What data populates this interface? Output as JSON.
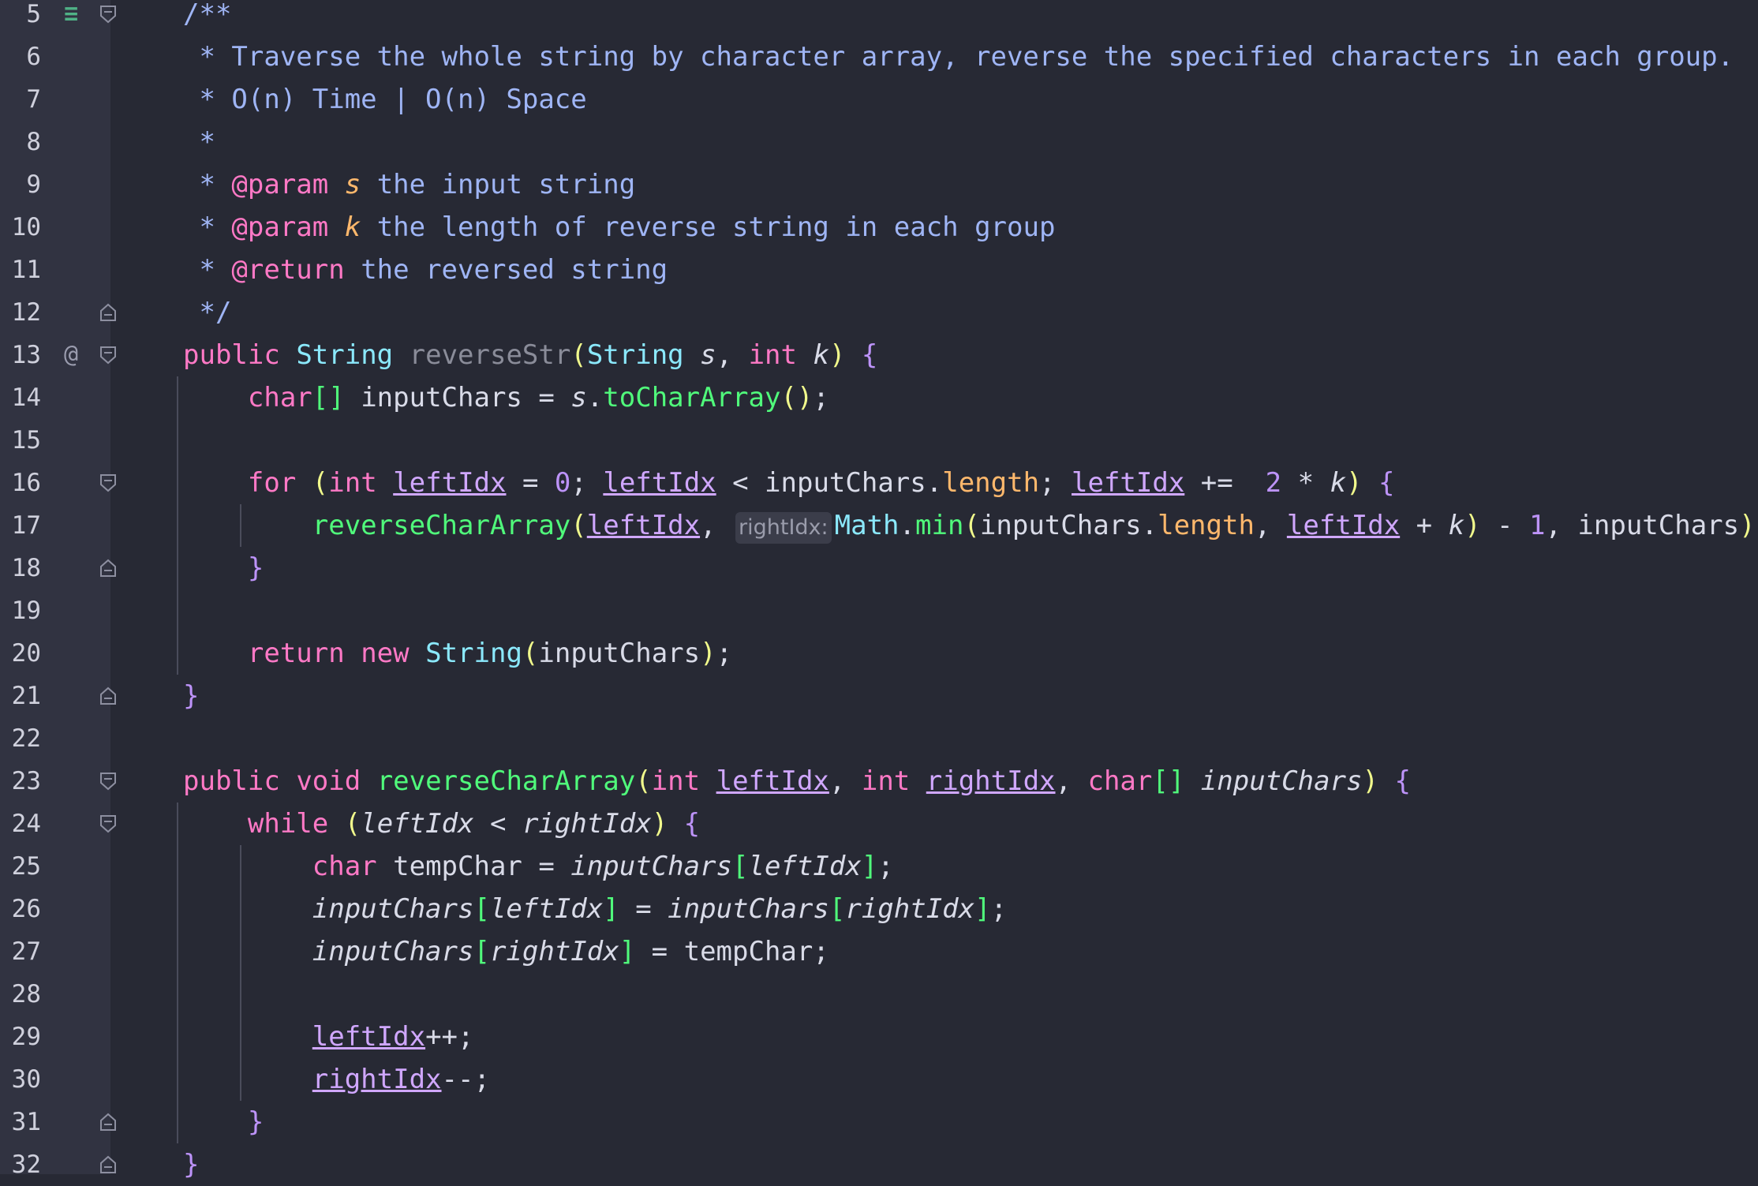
{
  "editor": {
    "lines": [
      {
        "n": "5",
        "icon": "implementation-gutter-icon",
        "fold": "open",
        "tokens": [
          [
            "/**",
            "cm"
          ]
        ]
      },
      {
        "n": "6",
        "tokens": [
          [
            " * Traverse the whole string by character array, reverse the specified characters in each group.",
            "cm"
          ]
        ]
      },
      {
        "n": "7",
        "tokens": [
          [
            " * O(n) Time | O(n) Space",
            "cm"
          ]
        ]
      },
      {
        "n": "8",
        "tokens": [
          [
            " *",
            "cm"
          ]
        ]
      },
      {
        "n": "9",
        "tokens": [
          [
            " * ",
            "cm"
          ],
          [
            "@param",
            "tag"
          ],
          [
            " ",
            "cm"
          ],
          [
            "s",
            "pn"
          ],
          [
            " the input string",
            "cm"
          ]
        ]
      },
      {
        "n": "10",
        "tokens": [
          [
            " * ",
            "cm"
          ],
          [
            "@param",
            "tag"
          ],
          [
            " ",
            "cm"
          ],
          [
            "k",
            "pn"
          ],
          [
            " the length of reverse string in each group",
            "cm"
          ]
        ]
      },
      {
        "n": "11",
        "tokens": [
          [
            " * ",
            "cm"
          ],
          [
            "@return",
            "tag"
          ],
          [
            " the reversed string",
            "cm"
          ]
        ]
      },
      {
        "n": "12",
        "fold": "close",
        "tokens": [
          [
            " */",
            "cm"
          ]
        ]
      },
      {
        "n": "13",
        "icon": "override-at-icon",
        "fold": "open",
        "tokens": [
          [
            "public",
            "kw"
          ],
          [
            " ",
            ""
          ],
          [
            "String",
            "ty"
          ],
          [
            " ",
            ""
          ],
          [
            "reverseStr",
            "fn2"
          ],
          [
            "(",
            "pa"
          ],
          [
            "String",
            "ty"
          ],
          [
            " ",
            ""
          ],
          [
            "s",
            "pi"
          ],
          [
            ", ",
            ""
          ],
          [
            "int",
            "kw"
          ],
          [
            " ",
            ""
          ],
          [
            "k",
            "pi"
          ],
          [
            ")",
            "pa"
          ],
          [
            " ",
            ""
          ],
          [
            "{",
            "br"
          ]
        ]
      },
      {
        "n": "14",
        "tokens": [
          [
            "    ",
            ""
          ],
          [
            "char",
            "kw"
          ],
          [
            "[]",
            "bk"
          ],
          [
            " inputChars = ",
            ""
          ],
          [
            "s",
            "pi"
          ],
          [
            ".",
            ""
          ],
          [
            "toCharArray",
            "fn"
          ],
          [
            "()",
            "pa"
          ],
          [
            ";",
            ""
          ]
        ]
      },
      {
        "n": "15",
        "tokens": []
      },
      {
        "n": "16",
        "fold": "open",
        "tokens": [
          [
            "    ",
            ""
          ],
          [
            "for",
            "kw"
          ],
          [
            " ",
            ""
          ],
          [
            "(",
            "pa"
          ],
          [
            "int",
            "kw"
          ],
          [
            " ",
            ""
          ],
          [
            "leftIdx",
            "lv"
          ],
          [
            " = ",
            ""
          ],
          [
            "0",
            "nu"
          ],
          [
            "; ",
            ""
          ],
          [
            "leftIdx",
            "lv"
          ],
          [
            " < inputChars.",
            ""
          ],
          [
            "length",
            "fd"
          ],
          [
            "; ",
            ""
          ],
          [
            "leftIdx",
            "lv"
          ],
          [
            " +=  ",
            ""
          ],
          [
            "2",
            "nu"
          ],
          [
            " * ",
            ""
          ],
          [
            "k",
            "pi"
          ],
          [
            ")",
            "pa"
          ],
          [
            " ",
            ""
          ],
          [
            "{",
            "br"
          ]
        ]
      },
      {
        "n": "17",
        "tokens": [
          [
            "        ",
            ""
          ],
          [
            "reverseCharArray",
            "fn"
          ],
          [
            "(",
            "pa"
          ],
          [
            "leftIdx",
            "lv"
          ],
          [
            ", ",
            ""
          ],
          [
            "rightIdx:",
            "hint"
          ],
          [
            "Math",
            "ty"
          ],
          [
            ".",
            ""
          ],
          [
            "min",
            "fn"
          ],
          [
            "(",
            "pa"
          ],
          [
            "inputChars.",
            ""
          ],
          [
            "length",
            "fd"
          ],
          [
            ", ",
            ""
          ],
          [
            "leftIdx",
            "lv"
          ],
          [
            " + ",
            ""
          ],
          [
            "k",
            "pi"
          ],
          [
            ")",
            "pa"
          ],
          [
            " - ",
            ""
          ],
          [
            "1",
            "nu"
          ],
          [
            ", inputChars",
            ""
          ],
          [
            ")",
            "pa"
          ],
          [
            ";",
            ""
          ]
        ]
      },
      {
        "n": "18",
        "fold": "close",
        "tokens": [
          [
            "    ",
            ""
          ],
          [
            "}",
            "br"
          ]
        ]
      },
      {
        "n": "19",
        "tokens": []
      },
      {
        "n": "20",
        "tokens": [
          [
            "    ",
            ""
          ],
          [
            "return",
            "kw"
          ],
          [
            " ",
            ""
          ],
          [
            "new",
            "kw"
          ],
          [
            " ",
            ""
          ],
          [
            "String",
            "ty"
          ],
          [
            "(",
            "pa"
          ],
          [
            "inputChars",
            ""
          ],
          [
            ")",
            "pa"
          ],
          [
            ";",
            ""
          ]
        ]
      },
      {
        "n": "21",
        "fold": "close",
        "tokens": [
          [
            "}",
            "br"
          ]
        ]
      },
      {
        "n": "22",
        "tokens": []
      },
      {
        "n": "23",
        "fold": "open",
        "tokens": [
          [
            "public",
            "kw"
          ],
          [
            " ",
            ""
          ],
          [
            "void",
            "kw"
          ],
          [
            " ",
            ""
          ],
          [
            "reverseCharArray",
            "fn"
          ],
          [
            "(",
            "pa"
          ],
          [
            "int",
            "kw"
          ],
          [
            " ",
            ""
          ],
          [
            "leftIdx",
            "lv"
          ],
          [
            ", ",
            ""
          ],
          [
            "int",
            "kw"
          ],
          [
            " ",
            ""
          ],
          [
            "rightIdx",
            "lv"
          ],
          [
            ", ",
            ""
          ],
          [
            "char",
            "kw"
          ],
          [
            "[]",
            "bk"
          ],
          [
            " ",
            ""
          ],
          [
            "inputChars",
            "pi"
          ],
          [
            ")",
            "pa"
          ],
          [
            " ",
            ""
          ],
          [
            "{",
            "br"
          ]
        ]
      },
      {
        "n": "24",
        "fold": "open",
        "tokens": [
          [
            "    ",
            ""
          ],
          [
            "while",
            "kw"
          ],
          [
            " ",
            ""
          ],
          [
            "(",
            "pa"
          ],
          [
            "leftIdx",
            "pi"
          ],
          [
            " < ",
            ""
          ],
          [
            "rightIdx",
            "pi"
          ],
          [
            ")",
            "pa"
          ],
          [
            " ",
            ""
          ],
          [
            "{",
            "br"
          ]
        ]
      },
      {
        "n": "25",
        "tokens": [
          [
            "        ",
            ""
          ],
          [
            "char",
            "kw"
          ],
          [
            " tempChar = ",
            ""
          ],
          [
            "inputChars",
            "pi"
          ],
          [
            "[",
            "bk"
          ],
          [
            "leftIdx",
            "pi"
          ],
          [
            "]",
            "bk"
          ],
          [
            ";",
            ""
          ]
        ]
      },
      {
        "n": "26",
        "tokens": [
          [
            "        ",
            ""
          ],
          [
            "inputChars",
            "pi"
          ],
          [
            "[",
            "bk"
          ],
          [
            "leftIdx",
            "pi"
          ],
          [
            "]",
            "bk"
          ],
          [
            " = ",
            ""
          ],
          [
            "inputChars",
            "pi"
          ],
          [
            "[",
            "bk"
          ],
          [
            "rightIdx",
            "pi"
          ],
          [
            "]",
            "bk"
          ],
          [
            ";",
            ""
          ]
        ]
      },
      {
        "n": "27",
        "tokens": [
          [
            "        ",
            ""
          ],
          [
            "inputChars",
            "pi"
          ],
          [
            "[",
            "bk"
          ],
          [
            "rightIdx",
            "pi"
          ],
          [
            "]",
            "bk"
          ],
          [
            " = tempChar;",
            ""
          ]
        ]
      },
      {
        "n": "28",
        "tokens": []
      },
      {
        "n": "29",
        "tokens": [
          [
            "        ",
            ""
          ],
          [
            "leftIdx",
            "lv"
          ],
          [
            "++;",
            ""
          ]
        ]
      },
      {
        "n": "30",
        "tokens": [
          [
            "        ",
            ""
          ],
          [
            "rightIdx",
            "lv"
          ],
          [
            "--;",
            ""
          ]
        ]
      },
      {
        "n": "31",
        "fold": "close",
        "tokens": [
          [
            "    ",
            ""
          ],
          [
            "}",
            "br"
          ]
        ]
      },
      {
        "n": "32",
        "fold": "close",
        "tokens": [
          [
            "}",
            "br"
          ]
        ]
      }
    ]
  }
}
